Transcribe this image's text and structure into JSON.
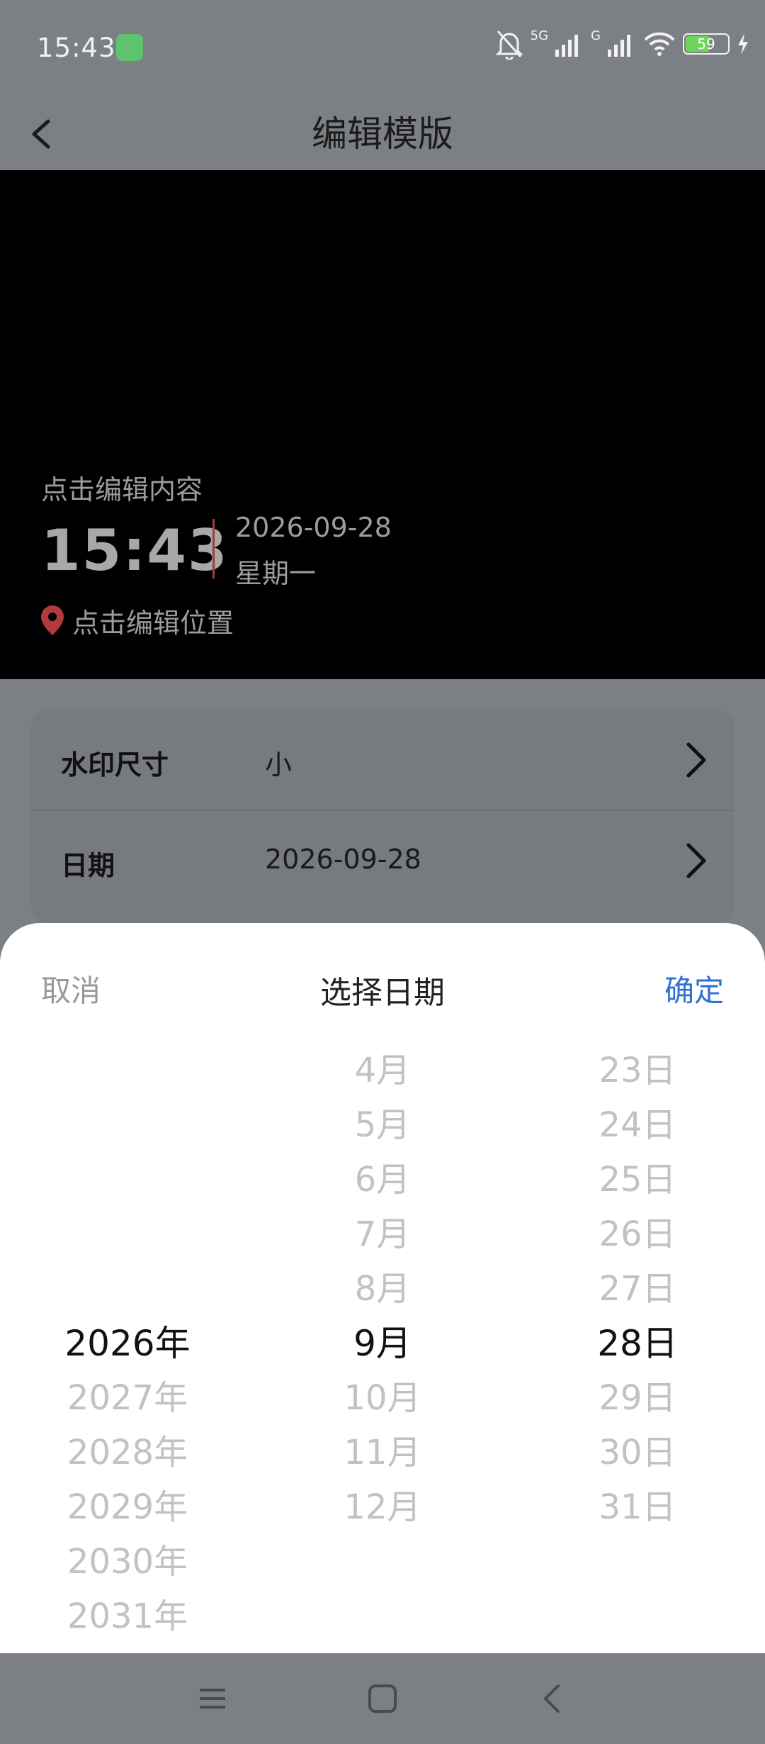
{
  "status_bar": {
    "time": "15:43",
    "network_1": "5G",
    "network_2": "G",
    "battery": "59"
  },
  "header": {
    "title": "编辑模版"
  },
  "watermark": {
    "edit_hint": "点击编辑内容",
    "time": "15:43",
    "date": "2026-09-28",
    "weekday": "星期一",
    "location_hint": "点击编辑位置"
  },
  "settings": [
    {
      "label": "水印尺寸",
      "value": "小"
    },
    {
      "label": "日期",
      "value": "2026-09-28"
    }
  ],
  "date_picker": {
    "cancel_label": "取消",
    "title": "选择日期",
    "confirm_label": "确定",
    "years": [
      "2026年",
      "2027年",
      "2028年",
      "2029年",
      "2030年",
      "2031年"
    ],
    "months": [
      "4月",
      "5月",
      "6月",
      "7月",
      "8月",
      "9月",
      "10月",
      "11月",
      "12月"
    ],
    "days": [
      "23日",
      "24日",
      "25日",
      "26日",
      "27日",
      "28日",
      "29日",
      "30日",
      "31日"
    ],
    "selected_year": "2026年",
    "selected_month": "9月",
    "selected_day": "28日"
  },
  "colors": {
    "accent": "#2f6fd8",
    "overlay": "#7c7f83",
    "location_pin": "#c0393b"
  },
  "icons": {
    "back": "chevron-left-icon",
    "row_arrow": "chevron-right-icon",
    "nav_menu": "menu-icon",
    "nav_home": "home-square-icon",
    "nav_back": "back-icon"
  }
}
